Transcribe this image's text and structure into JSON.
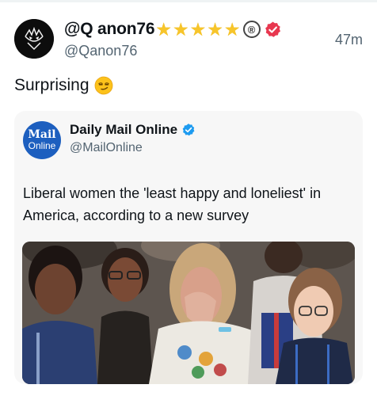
{
  "post": {
    "display_name": "@Q anon76",
    "star_glyph": "★",
    "registered_glyph": "®",
    "handle": "@Qanon76",
    "timestamp": "47m",
    "text": "Surprising",
    "badge_color": "#e8374f"
  },
  "quote": {
    "logo_line1": "Mail",
    "logo_line2": "Online",
    "name": "Daily Mail Online",
    "handle": "@MailOnline",
    "text": "Liberal women the 'least happy and loneliest' in America, according to a new survey",
    "logo_color": "#1d5fbf",
    "verified_color": "#1d9bf0"
  },
  "icons": {
    "avatar": "batman-mask-icon",
    "verified": "verified-badge-icon",
    "emoji": "smirk-emoji-icon"
  }
}
